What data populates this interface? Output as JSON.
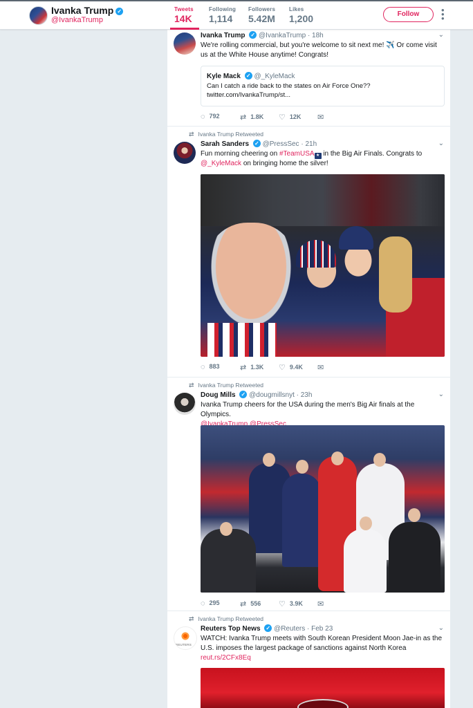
{
  "profile": {
    "name": "Ivanka Trump",
    "handle": "@IvankaTrump",
    "stats": [
      {
        "label": "Tweets",
        "value": "14K"
      },
      {
        "label": "Following",
        "value": "1,114"
      },
      {
        "label": "Followers",
        "value": "5.42M"
      },
      {
        "label": "Likes",
        "value": "1,200"
      }
    ],
    "follow_label": "Follow",
    "more_icon": "more-vertical-icon",
    "accent_color": "#e0245e"
  },
  "tweets": [
    {
      "name": "Ivanka Trump",
      "handle": "@IvankaTrump",
      "time": "· 18h",
      "text": "We're rolling commercial, but you're welcome to sit next me!",
      "text_emoji": "✈️",
      "text_tail": "Or come visit us at the White House anytime! Congrats!",
      "quote": {
        "name": "Kyle Mack",
        "handle": "@_KyleMack",
        "text": "Can I catch a ride back to the states on Air Force One?? twitter.com/IvankaTrump/st..."
      },
      "replies": "792",
      "retweets": "1.8K",
      "likes": "12K"
    },
    {
      "retweeted_by": "Ivanka Trump Retweeted",
      "name": "Sarah Sanders",
      "handle": "@PressSec",
      "time": "· 21h",
      "text_pre": "Fun morning cheering on",
      "hashtag": "#TeamUSA",
      "text_mid": "in the Big Air Finals. Congrats to",
      "mention": "@_KyleMack",
      "text_post": "on bringing home the silver!",
      "replies": "883",
      "retweets": "1.3K",
      "likes": "9.4K"
    },
    {
      "retweeted_by": "Ivanka Trump Retweeted",
      "name": "Doug Mills",
      "handle": "@dougmillsnyt",
      "time": "· 23h",
      "text": "Ivanka Trump cheers for the USA during the men's Big Air finals at the Olympics.",
      "mentions": "@IvankaTrump @PressSec",
      "replies": "295",
      "retweets": "556",
      "likes": "3.9K"
    },
    {
      "retweeted_by": "Ivanka Trump Retweeted",
      "name": "Reuters Top News",
      "handle": "@Reuters",
      "time": "· Feb 23",
      "avatar_word": "REUTERS",
      "text": "WATCH: Ivanka Trump meets with South Korean President Moon Jae-in as the U.S. imposes the largest package of sanctions against North Korea",
      "link": "reut.rs/2CFx8Eq"
    }
  ]
}
